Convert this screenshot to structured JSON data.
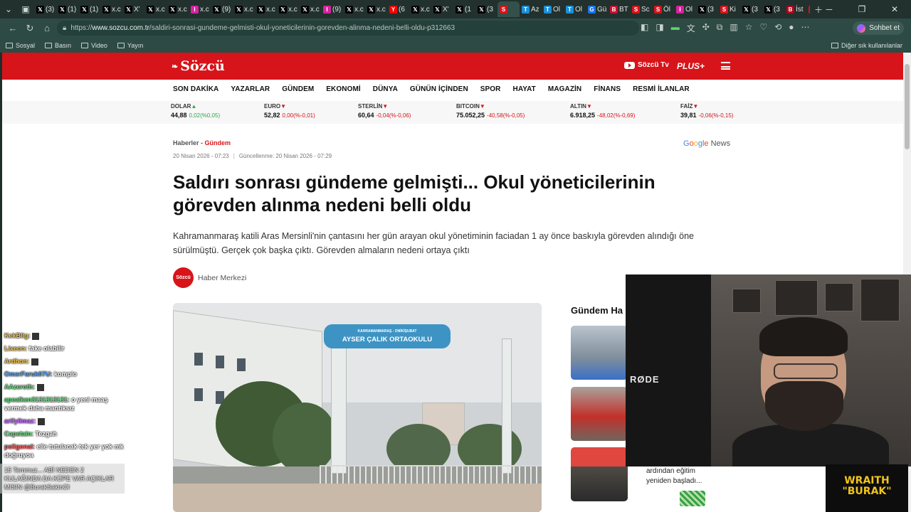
{
  "browser": {
    "tabs": [
      {
        "icon": "X",
        "label": "(3)"
      },
      {
        "icon": "X",
        "label": "(1)"
      },
      {
        "icon": "X",
        "label": "(1)"
      },
      {
        "icon": "X",
        "label": "x.c"
      },
      {
        "icon": "X",
        "label": "X'"
      },
      {
        "icon": "X",
        "label": "x.c"
      },
      {
        "icon": "X",
        "label": "x.c"
      },
      {
        "icon": "IG",
        "label": "x.c"
      },
      {
        "icon": "X",
        "label": "(9)"
      },
      {
        "icon": "X",
        "label": "x.c"
      },
      {
        "icon": "X",
        "label": "x.c"
      },
      {
        "icon": "X",
        "label": "x.c"
      },
      {
        "icon": "X",
        "label": "x.c"
      },
      {
        "icon": "IG",
        "label": "(9)"
      },
      {
        "icon": "X",
        "label": "x.c"
      },
      {
        "icon": "X",
        "label": "x.c"
      },
      {
        "icon": "YT",
        "label": "(6"
      },
      {
        "icon": "X",
        "label": "x.c"
      },
      {
        "icon": "X",
        "label": "X'"
      },
      {
        "icon": "X",
        "label": "(1"
      },
      {
        "icon": "X",
        "label": "(3"
      },
      {
        "icon": "S",
        "label": ""
      },
      {
        "icon": "TR",
        "label": "Az"
      },
      {
        "icon": "TR",
        "label": "Ol"
      },
      {
        "icon": "TR",
        "label": "Ol"
      },
      {
        "icon": "G",
        "label": "Gü"
      },
      {
        "icon": "BT",
        "label": "BT"
      },
      {
        "icon": "S",
        "label": "Sc"
      },
      {
        "icon": "S",
        "label": "Öl"
      },
      {
        "icon": "IG",
        "label": "Ol"
      },
      {
        "icon": "X",
        "label": "(3"
      },
      {
        "icon": "S",
        "label": "Ki"
      },
      {
        "icon": "X",
        "label": "(3"
      },
      {
        "icon": "X",
        "label": "(3"
      },
      {
        "icon": "B",
        "label": "İst"
      },
      {
        "icon": "S",
        "label": "Sa"
      }
    ],
    "url_domain": "www.sozcu.com.tr",
    "url_path": "/saldiri-sonrasi-gundeme-gelmisti-okul-yoneticilerinin-gorevden-alinma-nedeni-belli-oldu-p312663",
    "url_scheme": "https://",
    "copilot_label": "Sohbet et",
    "bookmarks": [
      "Sosyal",
      "Basın",
      "Video",
      "Yayın"
    ],
    "other_bookmarks": "Diğer sık kullanılanlar"
  },
  "site": {
    "logo": "Sözcü",
    "tv_label": "Sözcü Tv",
    "plus_label": "PLUS+",
    "nav": [
      "SON DAKİKA",
      "YAZARLAR",
      "GÜNDEM",
      "EKONOMİ",
      "DÜNYA",
      "GÜNÜN İÇİNDEN",
      "SPOR",
      "HAYAT",
      "MAGAZİN",
      "FİNANS",
      "RESMİ İLANLAR"
    ]
  },
  "tickers": [
    {
      "name": "DOLAR",
      "dir": "up",
      "value": "44,88",
      "change": "0,02(%0,05)"
    },
    {
      "name": "EURO",
      "dir": "down",
      "value": "52,82",
      "change": "0,00(%-0,01)"
    },
    {
      "name": "STERLİN",
      "dir": "down",
      "value": "60,64",
      "change": "-0,04(%-0,06)"
    },
    {
      "name": "BITCOIN",
      "dir": "down",
      "value": "75.052,25",
      "change": "-40,58(%-0,05)"
    },
    {
      "name": "ALTIN",
      "dir": "down",
      "value": "6.918,25",
      "change": "-48,02(%-0,69)"
    },
    {
      "name": "FAİZ",
      "dir": "down",
      "value": "39,81",
      "change": "-0,06(%-0,15)"
    }
  ],
  "article": {
    "breadcrumb_home": "Haberler",
    "breadcrumb_sep": " - ",
    "breadcrumb_category": "Gündem",
    "google_news": {
      "g": "G",
      "o1": "o",
      "o2": "o",
      "g2": "g",
      "l": "l",
      "e": "e",
      "rest": " News"
    },
    "published": "20 Nisan 2026 - 07:23",
    "updated": "Güncellenme: 20 Nisan 2026 - 07:29",
    "title": "Saldırı sonrası gündeme gelmişti... Okul yöneticilerinin görevden alınma nedeni belli oldu",
    "spot": "Kahramanmaraş katili Aras Mersinli'nin çantasını her gün arayan okul yönetiminin faciadan 1 ay önce baskıyla görevden alındığı öne sürülmüştü. Gerçek çok başka çıktı. Görevden almaların nedeni ortaya çıktı",
    "author_avatar": "Sözcü",
    "author": "Haber Merkezi",
    "image_sign_small": "KAHRAMANMARAŞ - ONİKİŞUBAT",
    "image_sign": "AYSER ÇALIK ORTAOKULU"
  },
  "sidebar": {
    "title": "Gündem Ha"
  },
  "stream": {
    "mic_label": "RØDE",
    "overlay_caption": "ardından eğitim yeniden başladı...",
    "badge_line1": "WRAITH",
    "badge_line2": "\"BURAK\"",
    "chat": [
      {
        "user": "KekBlig:",
        "color": "#f3c84a",
        "msg": "",
        "emote": true
      },
      {
        "user": "Lixeon:",
        "color": "#f3c84a",
        "msg": "fake olabilir",
        "emote": false
      },
      {
        "user": "Ardhon:",
        "color": "#f3c84a",
        "msg": "",
        "emote": true
      },
      {
        "user": "OmerFaruk07U:",
        "color": "#4aa3ff",
        "msg": "komplo",
        "emote": false
      },
      {
        "user": "AAzeroth:",
        "color": "#5fe07a",
        "msg": "",
        "emote": true
      },
      {
        "user": "apealken3131313131:",
        "color": "#5fe07a",
        "msg": "o yeni maaş vermek daha mantıksız",
        "emote": false
      },
      {
        "user": "arifyilmaz:",
        "color": "#c46bff",
        "msg": "",
        "emote": true
      },
      {
        "user": "Capetain:",
        "color": "#5fe07a",
        "msg": "Tezgah",
        "emote": false
      },
      {
        "user": "poligonal:",
        "color": "#ff5a5a",
        "msg": "elle tutulacak tek yer yok mk doğruyoa",
        "emote": false
      }
    ],
    "highlight": "15 Temmuz... ABİ NEDEN 2 KULAĞINDA DA KÜPE VAR AÇIKLAR MISIN @BurakSakinOl"
  }
}
